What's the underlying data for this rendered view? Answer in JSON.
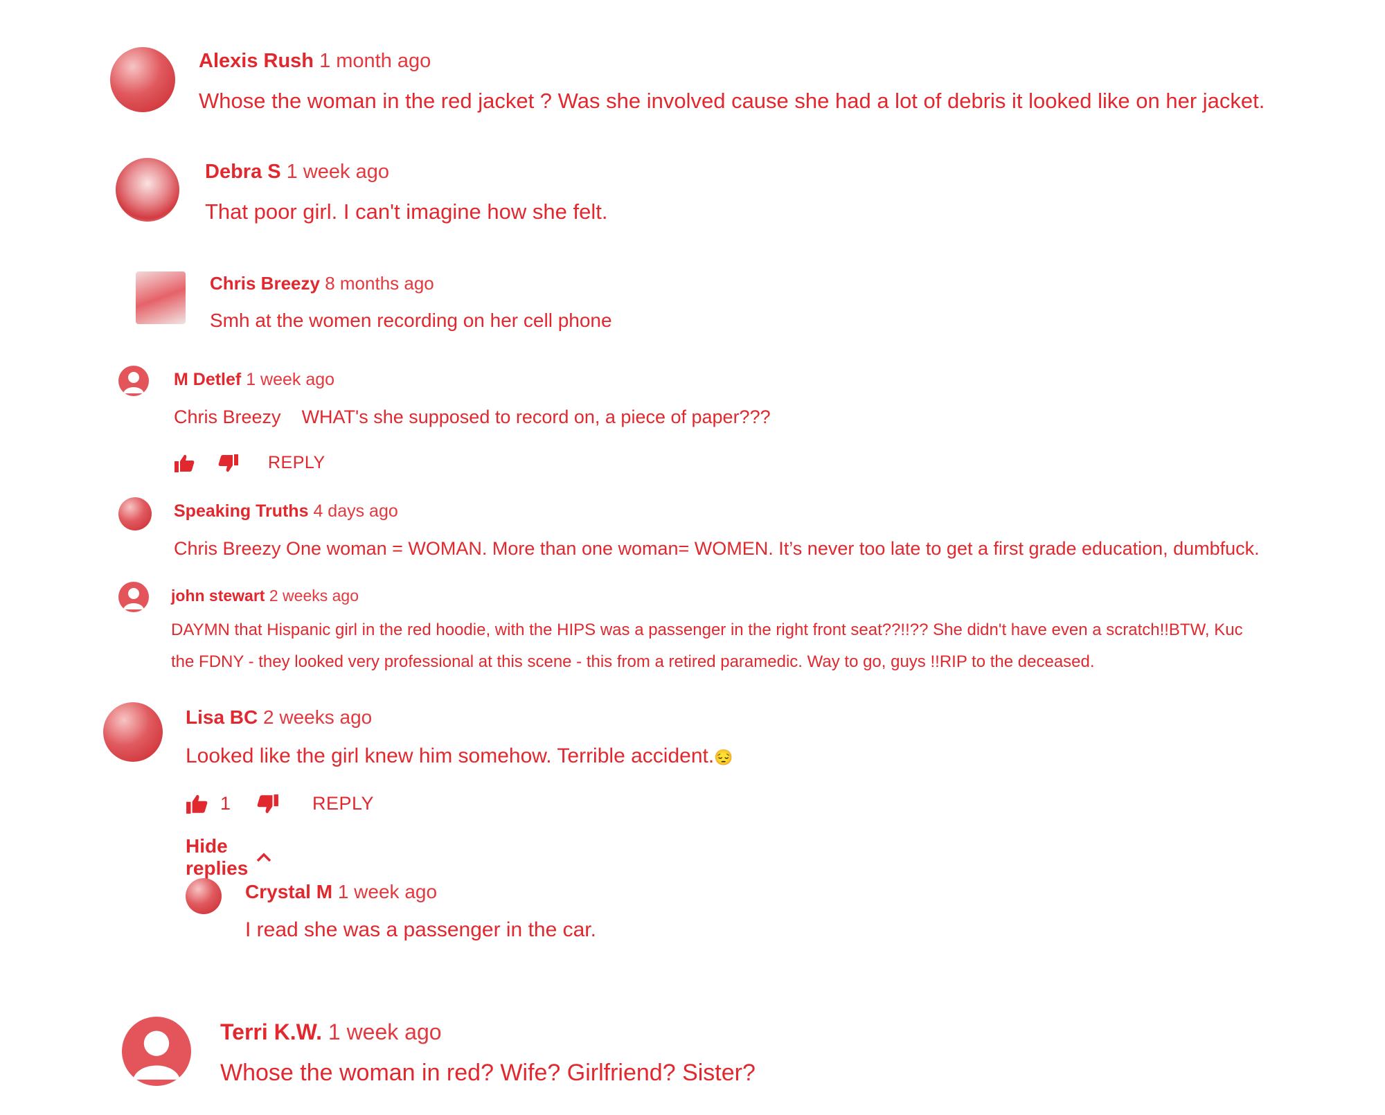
{
  "comments": [
    {
      "author": "Alexis Rush",
      "time": "1 month ago",
      "text": "Whose the woman in the red jacket ? Was she involved cause she had a lot of debris it looked like on her jacket."
    },
    {
      "author": "Debra S",
      "time": "1 week ago",
      "text": "That poor girl. I can't imagine how she felt."
    },
    {
      "author": "Chris Breezy",
      "time": "8 months ago",
      "text": "Smh at the women recording on her cell phone"
    },
    {
      "author": "M Detlef",
      "time": "1 week ago",
      "mention": "Chris Breezy",
      "text": "WHAT's she supposed to record on,  a piece of paper???",
      "reply_label": "REPLY"
    },
    {
      "author": "Speaking Truths",
      "time": "4 days ago",
      "text": "Chris Breezy One woman = WOMAN. More than one woman= WOMEN. It’s never too late to get a first grade education, dumbfuck."
    },
    {
      "author": "john stewart",
      "time": "2 weeks ago",
      "text_line1": "DAYMN that Hispanic girl in the red hoodie, with the HIPS was a passenger in the right front seat??!!??  She didn't have even a scratch!!BTW, Kuc",
      "text_line2": "the FDNY - they looked very professional at this scene - this from a retired paramedic.  Way to go, guys !!RIP to the deceased."
    },
    {
      "author": "Lisa BC",
      "time": "2 weeks ago",
      "text": "Looked like the girl knew him somehow. Terrible accident.",
      "emoji": "😔",
      "like_count": "1",
      "reply_label": "REPLY",
      "hide_replies": "Hide replies"
    },
    {
      "author": "Crystal M",
      "time": "1 week ago",
      "text": "I read she was a passenger in the car."
    },
    {
      "author": "Terri K.W.",
      "time": "1 week ago",
      "text": "Whose the woman in red? Wife? Girlfriend? Sister?"
    }
  ],
  "icons": {
    "like": "thumbs-up-icon",
    "dislike": "thumbs-down-icon",
    "chevron": "chevron-up-icon",
    "default_avatar": "person-icon"
  },
  "colors": {
    "text": "#e0282e",
    "background": "#ffffff"
  }
}
